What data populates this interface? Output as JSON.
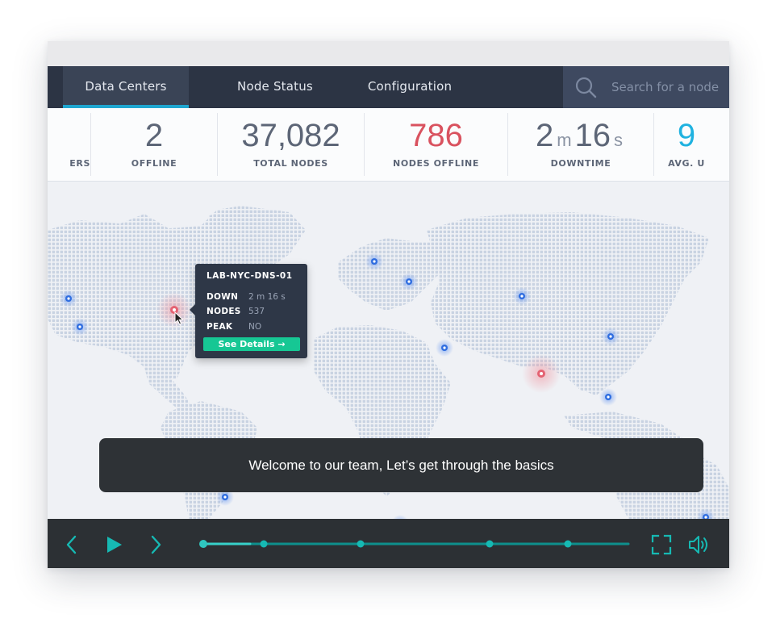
{
  "nav": {
    "tabs": [
      {
        "label": "Data Centers",
        "active": true
      },
      {
        "label": "Node Status",
        "active": false
      },
      {
        "label": "Configuration",
        "active": false
      }
    ],
    "search_placeholder": "Search for a node"
  },
  "stats": [
    {
      "value": "",
      "label": "ERS",
      "color": "#5d6677"
    },
    {
      "value": "2",
      "label": "OFFLINE",
      "color": "#5d6677"
    },
    {
      "value": "37,082",
      "label": "TOTAL NODES",
      "color": "#5d6677"
    },
    {
      "value": "786",
      "label": "NODES OFFLINE",
      "color": "#d9525f"
    },
    {
      "value_minutes": "2",
      "unit_minutes": "m",
      "value_seconds": "16",
      "unit_seconds": "s",
      "label": "DOWNTIME",
      "color": "#5d6677"
    },
    {
      "value": "9",
      "label": "AVG. U",
      "color": "#1fb2e0"
    }
  ],
  "tooltip": {
    "title": "LAB-NYC-DNS-01",
    "rows": [
      {
        "key": "DOWN",
        "value": "2 m 16 s"
      },
      {
        "key": "NODES",
        "value": "537"
      },
      {
        "key": "PEAK",
        "value": "NO"
      }
    ],
    "button_label": "See Details →"
  },
  "map": {
    "status_colors": {
      "online": "#3c74de",
      "offline": "#e06472"
    }
  },
  "caption": {
    "text": "Welcome to our team, Let’s get through the basics"
  },
  "player": {
    "progress": 0.11,
    "accent": "#16b9b3",
    "icons": [
      "chevron-left-icon",
      "play-icon",
      "chevron-right-icon",
      "fullscreen-icon",
      "volume-icon"
    ]
  }
}
